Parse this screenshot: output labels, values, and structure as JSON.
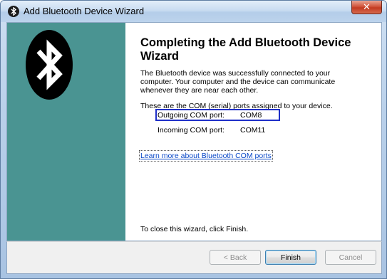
{
  "window": {
    "title": "Add Bluetooth Device Wizard",
    "close_symbol": "✕",
    "icons": {
      "app": "bluetooth-icon",
      "close": "close-icon",
      "logo": "bluetooth-logo"
    }
  },
  "content": {
    "heading": "Completing the Add Bluetooth Device Wizard",
    "description": "The Bluetooth device was successfully connected to your computer. Your computer and the device can communicate whenever they are near each other.",
    "ports_intro": "These are the COM (serial) ports assigned to your device.",
    "ports": [
      {
        "label": "Outgoing COM port:",
        "value": "COM8"
      },
      {
        "label": "Incoming COM port:",
        "value": "COM11"
      }
    ],
    "learn_more_link": "Learn more about Bluetooth COM ports",
    "close_hint": "To close this wizard, click Finish."
  },
  "buttons": {
    "back": "< Back",
    "finish": "Finish",
    "cancel": "Cancel"
  },
  "colors": {
    "side_panel": "#4a9492",
    "focus_border": "#1f2fc8",
    "link": "#0a49c8",
    "close_button": "#c23a21"
  }
}
